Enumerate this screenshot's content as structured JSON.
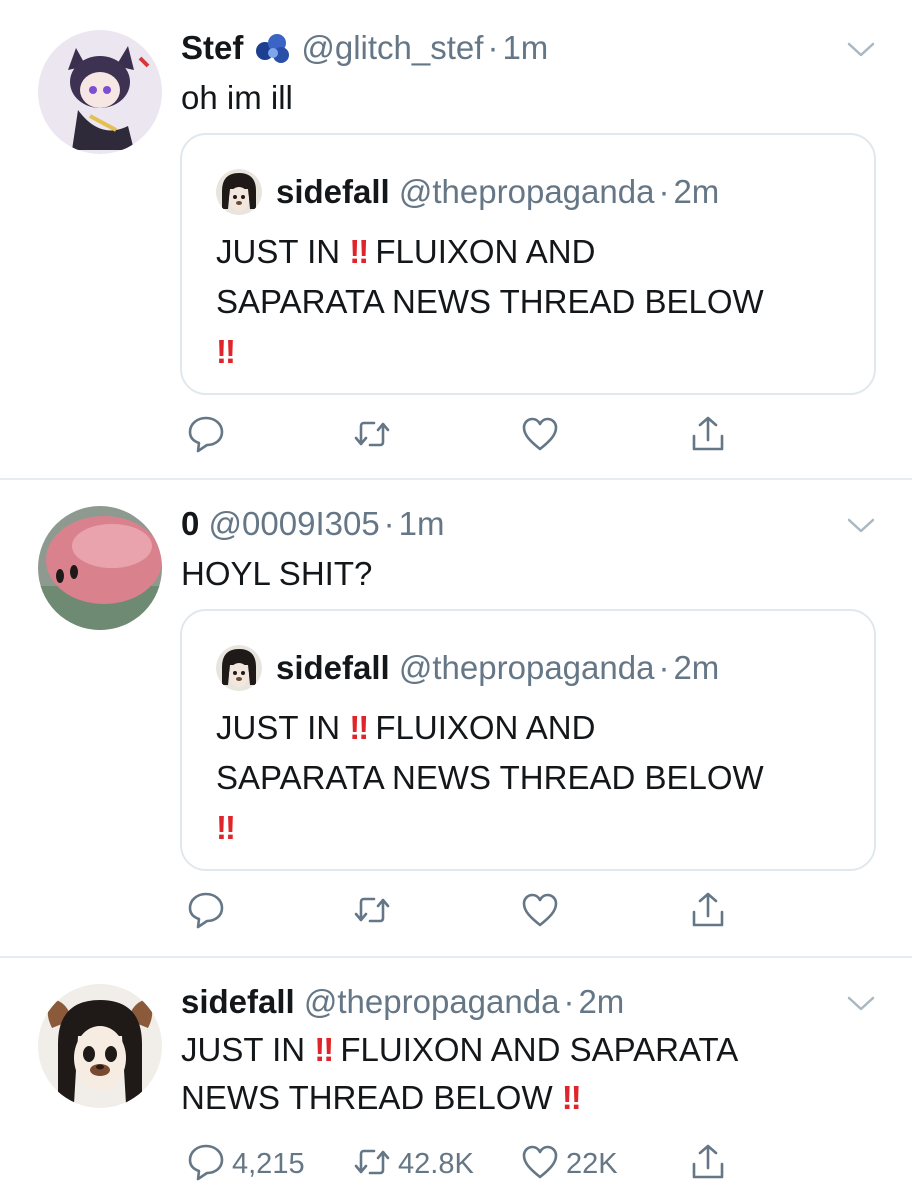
{
  "tweets": [
    {
      "name": "Stef",
      "handle": "@glitch_stef",
      "dot": "·",
      "time": "1m",
      "text": "oh im ill",
      "quote": {
        "name": "sidefall",
        "handle": "@thepropaganda",
        "dot": "·",
        "time": "2m",
        "text_a": "JUST IN",
        "bang": "‼",
        "text_b": "FLUIXON AND",
        "text_c": "SAPARATA NEWS THREAD BELOW"
      }
    },
    {
      "name": "0",
      "handle": "@0009I305",
      "dot": "·",
      "time": "1m",
      "text": "HOYL SHIT?",
      "quote": {
        "name": "sidefall",
        "handle": "@thepropaganda",
        "dot": "·",
        "time": "2m",
        "text_a": "JUST IN",
        "bang": "‼",
        "text_b": "FLUIXON AND",
        "text_c": "SAPARATA NEWS THREAD BELOW"
      }
    },
    {
      "name": "sidefall",
      "handle": "@thepropaganda",
      "dot": "·",
      "time": "2m",
      "text_a": "JUST IN",
      "bang": "‼",
      "text_b": "FLUIXON AND SAPARATA",
      "text_c": "NEWS THREAD BELOW",
      "replies": "4,215",
      "retweets": "42.8K",
      "likes": "22K"
    }
  ],
  "icons": [
    "chevron-down-icon",
    "reply-icon",
    "retweet-icon",
    "like-icon",
    "share-icon",
    "verified-badge-icon"
  ],
  "colors": {
    "text": "#14171a",
    "muted": "#657786",
    "divider": "#e6ecf0",
    "emphasis": "#e0242b"
  }
}
